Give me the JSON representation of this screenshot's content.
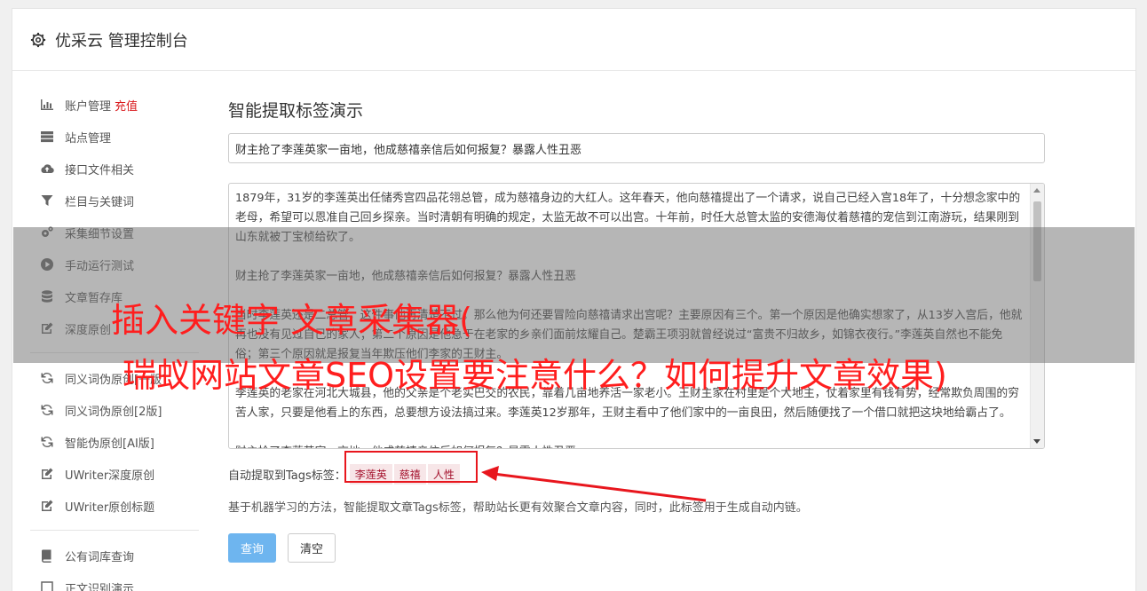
{
  "header": {
    "title": "优采云 管理控制台"
  },
  "sidebar": {
    "items": [
      {
        "label": "账户管理",
        "badge": "充值",
        "icon": "bar-chart-icon"
      },
      {
        "label": "站点管理",
        "icon": "server-icon"
      },
      {
        "label": "接口文件相关",
        "icon": "cloud-upload-icon"
      },
      {
        "label": "栏目与关键词",
        "icon": "filter-icon"
      },
      {
        "label": "采集细节设置",
        "icon": "gears-icon"
      },
      {
        "label": "手动运行测试",
        "icon": "play-circle-icon"
      },
      {
        "label": "文章暂存库",
        "icon": "database-icon"
      },
      {
        "label": "深度原创",
        "icon": "edit-icon"
      }
    ],
    "items2": [
      {
        "label": "同义词伪原创[一版]",
        "icon": "refresh-icon"
      },
      {
        "label": "同义词伪原创[2版]",
        "icon": "refresh-icon"
      },
      {
        "label": "智能伪原创[AI版]",
        "icon": "refresh-icon"
      },
      {
        "label": "UWriter深度原创",
        "icon": "edit-icon"
      },
      {
        "label": "UWriter原创标题",
        "icon": "edit-icon"
      }
    ],
    "items3": [
      {
        "label": "公有词库查询",
        "icon": "book-icon"
      },
      {
        "label": "正文识别演示",
        "icon": "square-icon"
      }
    ]
  },
  "main": {
    "heading": "智能提取标签演示",
    "title_value": "财主抢了李莲英家一亩地，他成慈禧亲信后如何报复？暴露人性丑恶",
    "body_text": "1879年，31岁的李莲英出任储秀宫四品花翎总管，成为慈禧身边的大红人。这年春天，他向慈禧提出了一个请求，说自己已经入宫18年了，十分想念家中的老母，希望可以恩准自己回乡探亲。当时清朝有明确的规定，太监无故不可以出宫。十年前，时任大总管太监的安德海仗着慈禧的宠信到江南游玩，结果刚到山东就被丁宝桢给砍了。\n\n财主抢了李莲英家一亩地，他成慈禧亲信后如何报复？暴露人性丑恶\n\n当时李莲英还是二总管，这件事他再清楚不过。那么他为何还要冒险向慈禧请求出宫呢？主要原因有三个。第一个原因是他确实想家了，从13岁入宫后，他就再也没有见过自己的家人；第二个原因是他急于在老家的乡亲们面前炫耀自己。楚霸王项羽就曾经说过“富贵不归故乡，如锦衣夜行。”李莲英自然也不能免俗；第三个原因就是报复当年欺压他们李家的王财主。\n\n李莲英的老家在河北大城县，他的父亲是个老实巴交的农民，靠着几亩地养活一家老小。王财主家在村里是个大地主，仗着家里有钱有势，经常欺负周围的穷苦人家，只要是他看上的东西，总要想方设法搞过来。李莲英12岁那年，王财主看中了他们家中的一亩良田，然后随便找了一个借口就把这块地给霸占了。\n\n财主抢了李莲英家一亩地，他成慈禧亲信后如何报复？暴露人性丑恶",
    "tags_label": "自动提取到Tags标签：",
    "tags": [
      "李莲英",
      "慈禧",
      "人性"
    ],
    "description": "基于机器学习的方法，智能提取文章Tags标签，帮助站长更有效聚合文章内容，同时，此标签用于生成自动内链。",
    "query_button": "查询",
    "clear_button": "清空"
  },
  "overlay": {
    "line1": "插入关键字 文章采集器(",
    "line2": "瑞蚁网站文章SEO设置要注意什么？如何提升文章效果)"
  },
  "colors": {
    "accent": "#6eb5ef",
    "tag_text": "#a4112c",
    "badge": "#d9191d",
    "overlay_text": "#ff1e1e"
  }
}
